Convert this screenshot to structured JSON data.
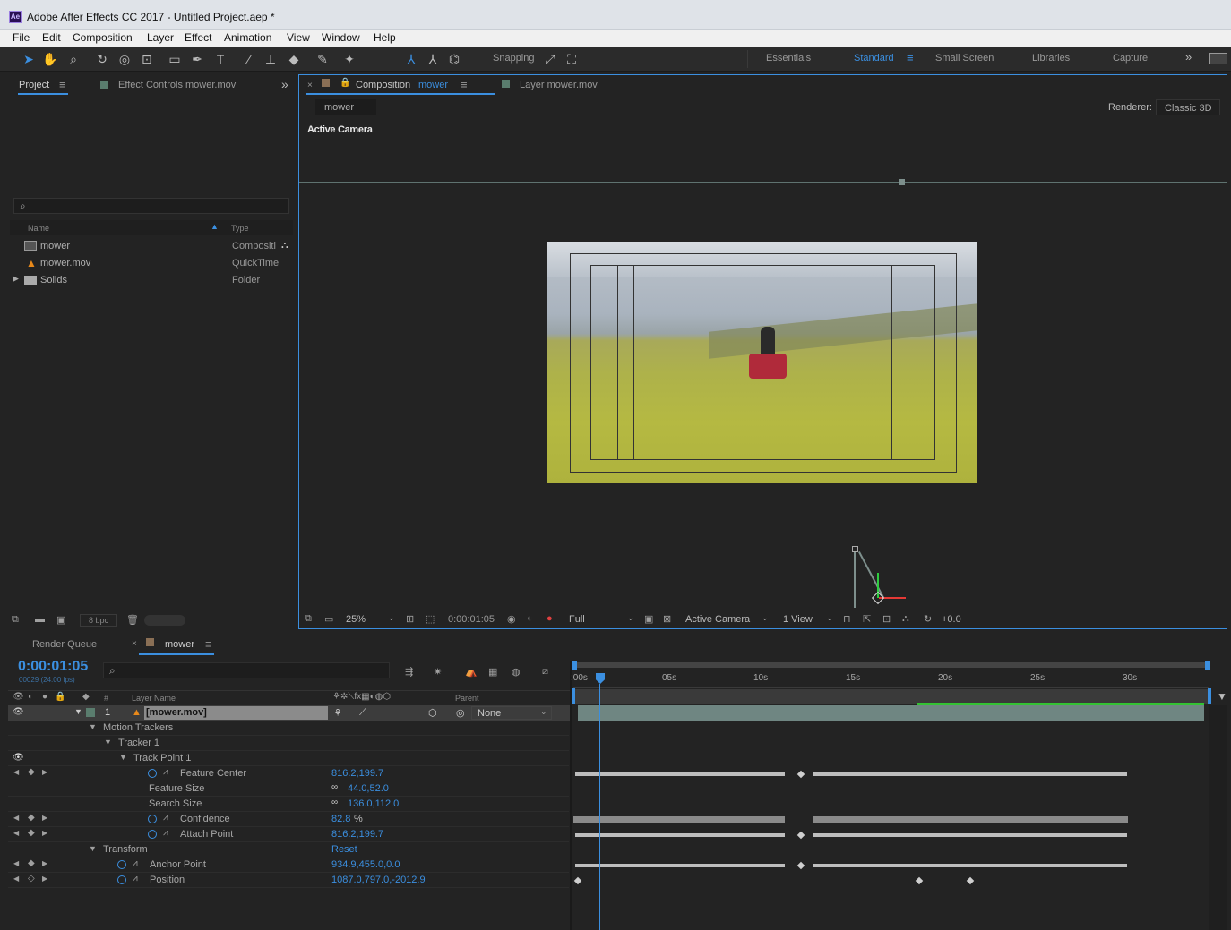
{
  "window": {
    "app_icon": "Ae",
    "title": "Adobe After Effects CC 2017 - Untitled Project.aep *"
  },
  "menu": [
    "File",
    "Edit",
    "Composition",
    "Layer",
    "Effect",
    "Animation",
    "View",
    "Window",
    "Help"
  ],
  "toolbar": {
    "snapping_label": "Snapping",
    "workspaces": [
      "Essentials",
      "Standard",
      "Small Screen",
      "Libraries",
      "Capture"
    ],
    "active_workspace": "Standard"
  },
  "project_panel": {
    "tab_project": "Project",
    "tab_effect_controls": "Effect Controls mower.mov",
    "col_name": "Name",
    "col_type": "Type",
    "items": [
      {
        "name": "mower",
        "type": "Compositi",
        "icon": "composition-icon"
      },
      {
        "name": "mower.mov",
        "type": "QuickTime",
        "icon": "footage-icon"
      },
      {
        "name": "Solids",
        "type": "Folder",
        "icon": "folder-icon"
      }
    ],
    "bpc": "8 bpc"
  },
  "composition_panel": {
    "tab_composition": "Composition",
    "tab_composition_name": "mower",
    "tab_layer": "Layer mower.mov",
    "breadcrumb": "mower",
    "renderer_label": "Renderer:",
    "renderer_value": "Classic 3D",
    "view_label": "Active Camera",
    "zoom": "25%",
    "timecode": "0:00:01:05",
    "resolution": "Full",
    "camera": "Active Camera",
    "views": "1 View",
    "exposure": "+0.0"
  },
  "timeline": {
    "tab_render_queue": "Render Queue",
    "tab_comp": "mower",
    "timecode": "0:00:01:05",
    "frame_info": "00029 (24.00 fps)",
    "col_layer_name": "Layer Name",
    "col_parent": "Parent",
    "col_number": "#",
    "ruler": [
      ":00s",
      "05s",
      "10s",
      "15s",
      "20s",
      "25s",
      "30s"
    ],
    "layer": {
      "number": "1",
      "name": "[mower.mov]",
      "parent": "None"
    },
    "rows": [
      {
        "label": "Motion Trackers",
        "value": ""
      },
      {
        "label": "Tracker 1",
        "value": ""
      },
      {
        "label": "Track Point 1",
        "value": ""
      },
      {
        "label": "Feature Center",
        "value": "816.2,199.7"
      },
      {
        "label": "Feature Size",
        "value": "44.0,52.0"
      },
      {
        "label": "Search Size",
        "value": "136.0,112.0"
      },
      {
        "label": "Confidence",
        "value": "82.8",
        "unit": "%"
      },
      {
        "label": "Attach Point",
        "value": "816.2,199.7"
      },
      {
        "label": "Transform",
        "value": "Reset"
      },
      {
        "label": "Anchor Point",
        "value": "934.9,455.0,0.0"
      },
      {
        "label": "Position",
        "value": "1087.0,797.0,-2012.9"
      }
    ]
  }
}
